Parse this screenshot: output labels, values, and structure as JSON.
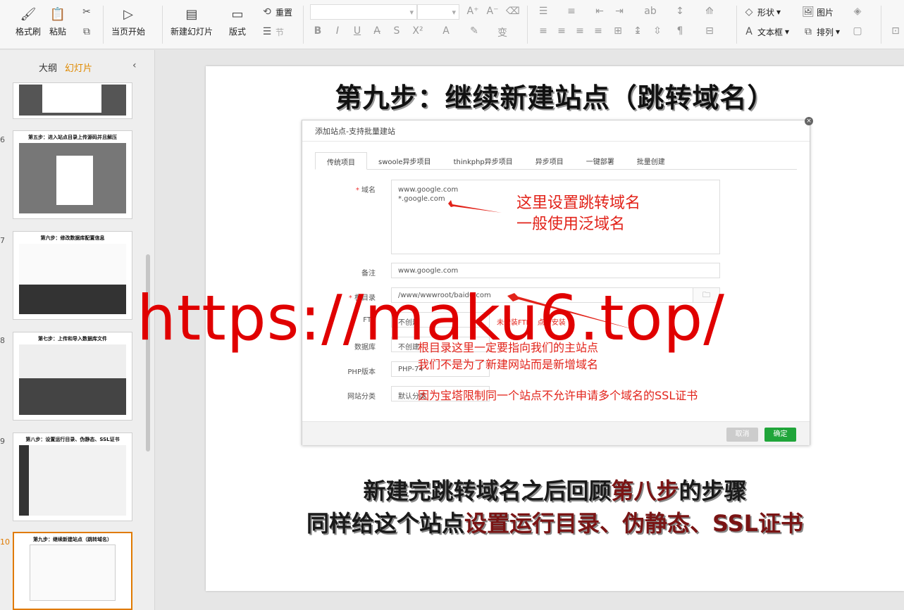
{
  "ribbon": {
    "format_painter": "格式刷",
    "paste": "粘贴",
    "from_current": "当页开始",
    "new_slide": "新建幻灯片",
    "layout": "版式",
    "reset": "重置",
    "section": "节",
    "shapes": "形状",
    "picture": "图片",
    "textbox": "文本框",
    "arrange": "排列"
  },
  "left_panel": {
    "tab_outline": "大纲",
    "tab_slides": "幻灯片",
    "slides": [
      {
        "num": "",
        "title": ""
      },
      {
        "num": "6",
        "title": "第五步：进入站点目录上传源码并且解压"
      },
      {
        "num": "7",
        "title": "第六步：修改数据库配置信息"
      },
      {
        "num": "8",
        "title": "第七步：上传和导入数据库文件"
      },
      {
        "num": "9",
        "title": "第八步：设置运行目录、伪静态、SSL证书"
      },
      {
        "num": "10",
        "title": "第九步：继续新建站点（跳转域名）"
      }
    ]
  },
  "slide": {
    "title": "第九步：继续新建站点（跳转域名）",
    "dialog": {
      "title": "添加站点-支持批量建站",
      "close": "×",
      "tabs": [
        "传统项目",
        "swoole异步项目",
        "thinkphp异步项目",
        "异步项目",
        "一键部署",
        "批量创建"
      ],
      "domain_label": "域名",
      "domain_lines": [
        "www.google.com",
        "*.google.com"
      ],
      "remark_label": "备注",
      "remark_value": "www.google.com",
      "root_label": "根目录",
      "root_value": "/www/wwwroot/baidu.com",
      "ftp_label": "FTP",
      "ftp_value": "不创建",
      "ftp_hint": "未安装FTP，点击安装",
      "db_label": "数据库",
      "db_value": "不创建",
      "php_label": "PHP版本",
      "php_value": "PHP-74",
      "category_label": "网站分类",
      "category_value": "默认分类",
      "cancel": "取消",
      "confirm": "确定"
    },
    "notes": {
      "domain_note_1": "这里设置跳转域名",
      "domain_note_2": "一般使用泛域名",
      "root_note_1": "根目录这里一定要指向我们的主站点",
      "root_note_2": "我们不是为了新建网站而是新增域名",
      "root_note_3": "因为宝塔限制同一个站点不允许申请多个域名的SSL证书"
    },
    "watermark": "https://maku6.top/",
    "caption_1a": "新建完跳转域名之后回顾",
    "caption_1b": "第八步",
    "caption_1c": "的步骤",
    "caption_2a": "同样给这个站点",
    "caption_2b": "设置运行目录、伪静态、SSL证书"
  }
}
